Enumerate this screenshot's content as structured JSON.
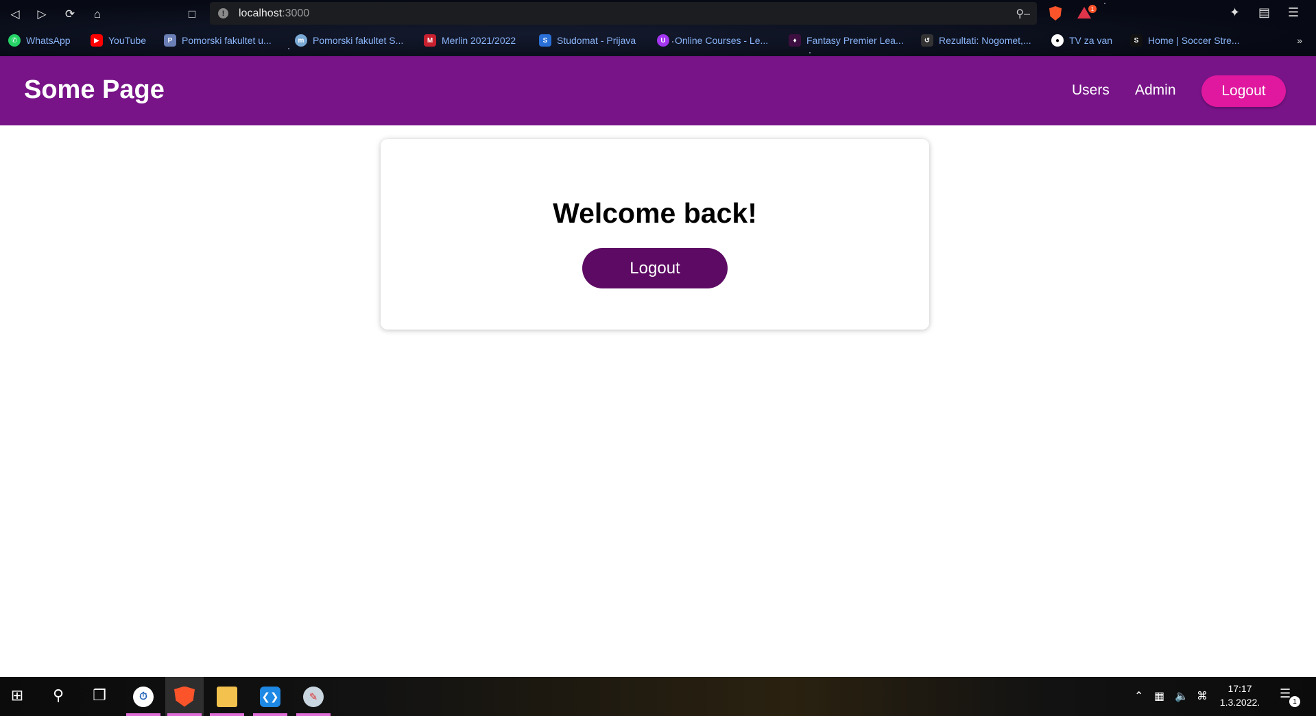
{
  "browser": {
    "url_host": "localhost",
    "url_port": ":3000",
    "rewards_badge": "1",
    "bookmarks": [
      {
        "label": "WhatsApp",
        "icon": "whatsapp-icon",
        "color": "#25d366"
      },
      {
        "label": "YouTube",
        "icon": "youtube-icon",
        "color": "#ff0000"
      },
      {
        "label": "Pomorski fakultet u...",
        "icon": "pomorski-icon",
        "color": "#6a7fb5"
      },
      {
        "label": "Pomorski fakultet S...",
        "icon": "moodle-icon",
        "color": "#7aa9d6"
      },
      {
        "label": "Merlin 2021/2022",
        "icon": "merlin-icon",
        "color": "#c8202f"
      },
      {
        "label": "Studomat - Prijava",
        "icon": "studomat-icon",
        "color": "#2a6fd6"
      },
      {
        "label": "Online Courses - Le...",
        "icon": "udemy-icon",
        "color": "#a435f0"
      },
      {
        "label": "Fantasy Premier Lea...",
        "icon": "premier-league-icon",
        "color": "#3d0e40"
      },
      {
        "label": "Rezultati: Nogomet,...",
        "icon": "rezultati-icon",
        "color": "#333333"
      },
      {
        "label": "TV za van",
        "icon": "globe-icon",
        "color": "#ffffff"
      },
      {
        "label": "Home | Soccer Stre...",
        "icon": "soccer-streams-icon",
        "color": "#111111"
      }
    ],
    "more_label": "»"
  },
  "header": {
    "brand": "Some Page",
    "nav": [
      {
        "label": "Users"
      },
      {
        "label": "Admin"
      }
    ],
    "logout_label": "Logout"
  },
  "card": {
    "title": "Welcome back!",
    "logout_label": "Logout"
  },
  "taskbar": {
    "time": "17:17",
    "date": "1.3.2022.",
    "notification_count": "1",
    "apps": [
      {
        "icon": "app-clock-icon"
      },
      {
        "icon": "brave-browser-icon"
      },
      {
        "icon": "file-explorer-icon"
      },
      {
        "icon": "vscode-icon"
      },
      {
        "icon": "paint-icon"
      }
    ]
  },
  "colors": {
    "header_bg": "#781488",
    "header_logout_bg": "#e0189f",
    "card_logout_bg": "#5c0a63",
    "link": "#8ab4f8"
  }
}
